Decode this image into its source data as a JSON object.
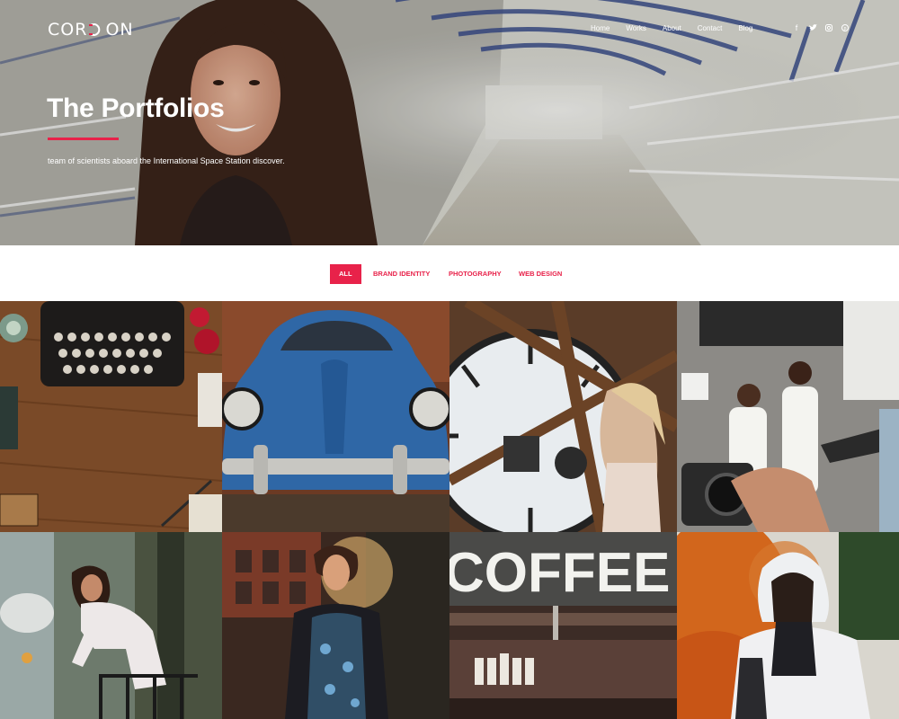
{
  "header": {
    "logo_text": "COR",
    "logo_text_end": "ON",
    "nav": [
      "Home",
      "Works",
      "About",
      "Contact",
      "Blog"
    ],
    "social_icons": [
      "facebook-icon",
      "twitter-icon",
      "instagram-icon",
      "pinterest-icon"
    ],
    "social_glyphs": [
      "f",
      "t",
      "◎",
      "℗"
    ]
  },
  "hero": {
    "title": "The Portfolios",
    "subtitle": "team of scientists aboard the International Space Station discover."
  },
  "filters": {
    "items": [
      "ALL",
      "BRAND IDENTITY",
      "PHOTOGRAPHY",
      "WEB DESIGN"
    ],
    "active": "ALL"
  },
  "gallery": {
    "tiles": [
      {
        "name": "typewriter-photo"
      },
      {
        "name": "blue-car-photo"
      },
      {
        "name": "clock-tower-photo"
      },
      {
        "name": "photoshoot-photo"
      },
      {
        "name": "balcony-woman-photo"
      },
      {
        "name": "sunset-woman-photo"
      },
      {
        "name": "coffee-shop-photo",
        "sign_text": "COFFEE"
      },
      {
        "name": "orange-smoke-photo"
      }
    ]
  },
  "colors": {
    "accent": "#e8224a",
    "text_light": "#ffffff"
  }
}
